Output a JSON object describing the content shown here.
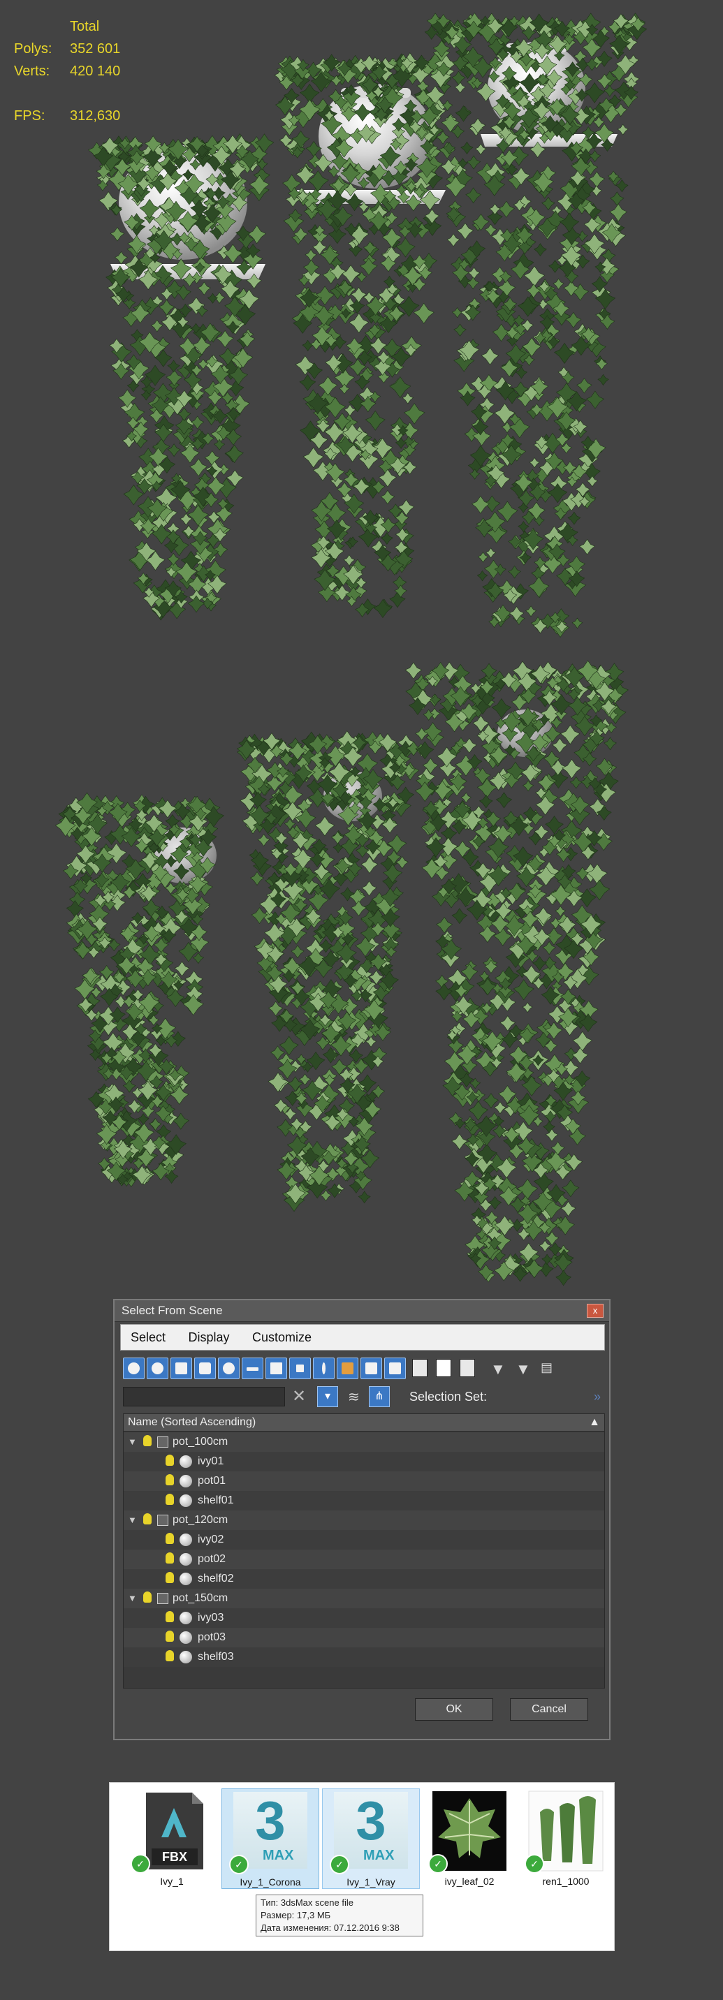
{
  "stats": {
    "header": "Total",
    "polys_label": "Polys:",
    "polys_value": "352 601",
    "verts_label": "Verts:",
    "verts_value": "420 140",
    "fps_label": "FPS:",
    "fps_value": "312,630"
  },
  "dialog": {
    "title": "Select From Scene",
    "close": "x",
    "menu": [
      "Select",
      "Display",
      "Customize"
    ],
    "search_value": "",
    "selection_set_label": "Selection Set:",
    "column_header": "Name (Sorted Ascending)",
    "tree": [
      {
        "name": "pot_100cm",
        "children": [
          "ivy01",
          "pot01",
          "shelf01"
        ]
      },
      {
        "name": "pot_120cm",
        "children": [
          "ivy02",
          "pot02",
          "shelf02"
        ]
      },
      {
        "name": "pot_150cm",
        "children": [
          "ivy03",
          "pot03",
          "shelf03"
        ]
      }
    ],
    "ok_label": "OK",
    "cancel_label": "Cancel"
  },
  "explorer": {
    "files": [
      {
        "name": "Ivy_1",
        "badge": "FBX"
      },
      {
        "name": "Ivy_1_Corona",
        "badge": "MAX"
      },
      {
        "name": "Ivy_1_Vray",
        "badge": "MAX"
      },
      {
        "name": "ivy_leaf_02",
        "badge": ""
      },
      {
        "name": "ren1_1000",
        "badge": ""
      }
    ],
    "tooltip": {
      "type": "Тип: 3dsMax scene file",
      "size": "Размер: 17,3 МБ",
      "date": "Дата изменения: 07.12.2016 9:38"
    }
  },
  "colors": {
    "viewport": "#434343",
    "stats_text": "#e8d62a",
    "ivy_dark": "#2d4a25",
    "ivy_mid": "#4f7a3f",
    "ivy_light": "#8fb37a",
    "button_blue": "#3b78c4"
  }
}
